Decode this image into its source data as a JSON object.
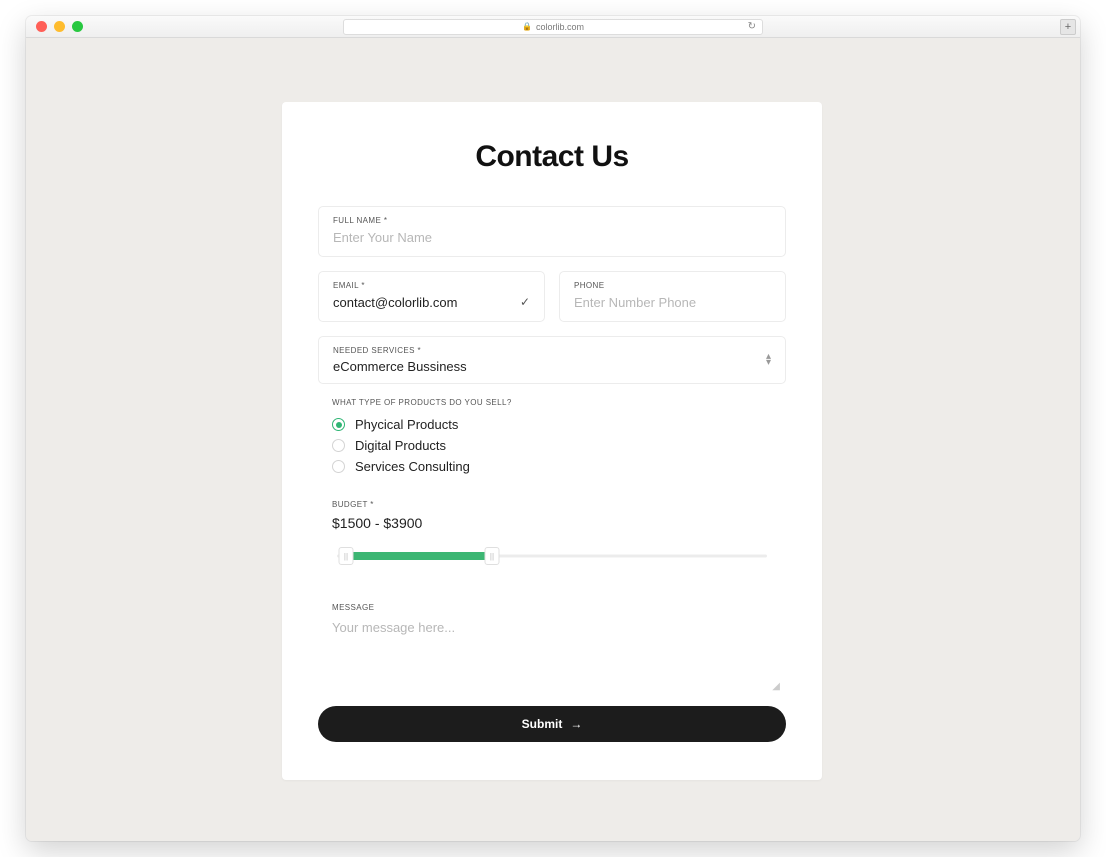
{
  "browser": {
    "url": "colorlib.com"
  },
  "form": {
    "title": "Contact Us",
    "fullname": {
      "label": "FULL NAME *",
      "placeholder": "Enter Your Name",
      "value": ""
    },
    "email": {
      "label": "EMAIL *",
      "placeholder": "",
      "value": "contact@colorlib.com"
    },
    "phone": {
      "label": "PHONE",
      "placeholder": "Enter Number Phone",
      "value": ""
    },
    "service": {
      "label": "NEEDED SERVICES *",
      "value": "eCommerce Bussiness"
    },
    "products": {
      "label": "WHAT TYPE OF PRODUCTS DO YOU SELL?",
      "options": [
        "Phycical Products",
        "Digital Products",
        "Services Consulting"
      ],
      "selected_index": 0
    },
    "budget": {
      "label": "BUDGET *",
      "value": "$1500 - $3900"
    },
    "message": {
      "label": "MESSAGE",
      "placeholder": "Your message here...",
      "value": ""
    },
    "submit": "Submit"
  }
}
